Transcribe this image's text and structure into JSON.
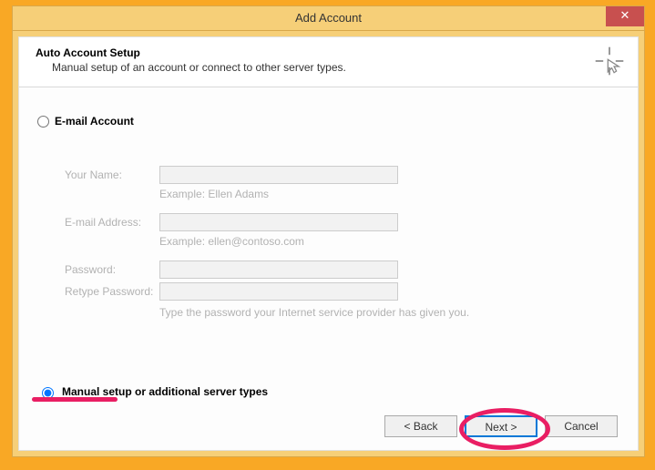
{
  "window": {
    "title": "Add Account",
    "close": "✕"
  },
  "header": {
    "title": "Auto Account Setup",
    "subtitle": "Manual setup of an account or connect to other server types."
  },
  "options": {
    "email_account": "E-mail Account",
    "manual_setup": "Manual setup or additional server types"
  },
  "form": {
    "your_name_label": "Your Name:",
    "your_name_example": "Example: Ellen Adams",
    "email_label": "E-mail Address:",
    "email_example": "Example: ellen@contoso.com",
    "password_label": "Password:",
    "retype_password_label": "Retype Password:",
    "password_hint": "Type the password your Internet service provider has given you."
  },
  "buttons": {
    "back": "< Back",
    "next": "Next >",
    "cancel": "Cancel"
  }
}
